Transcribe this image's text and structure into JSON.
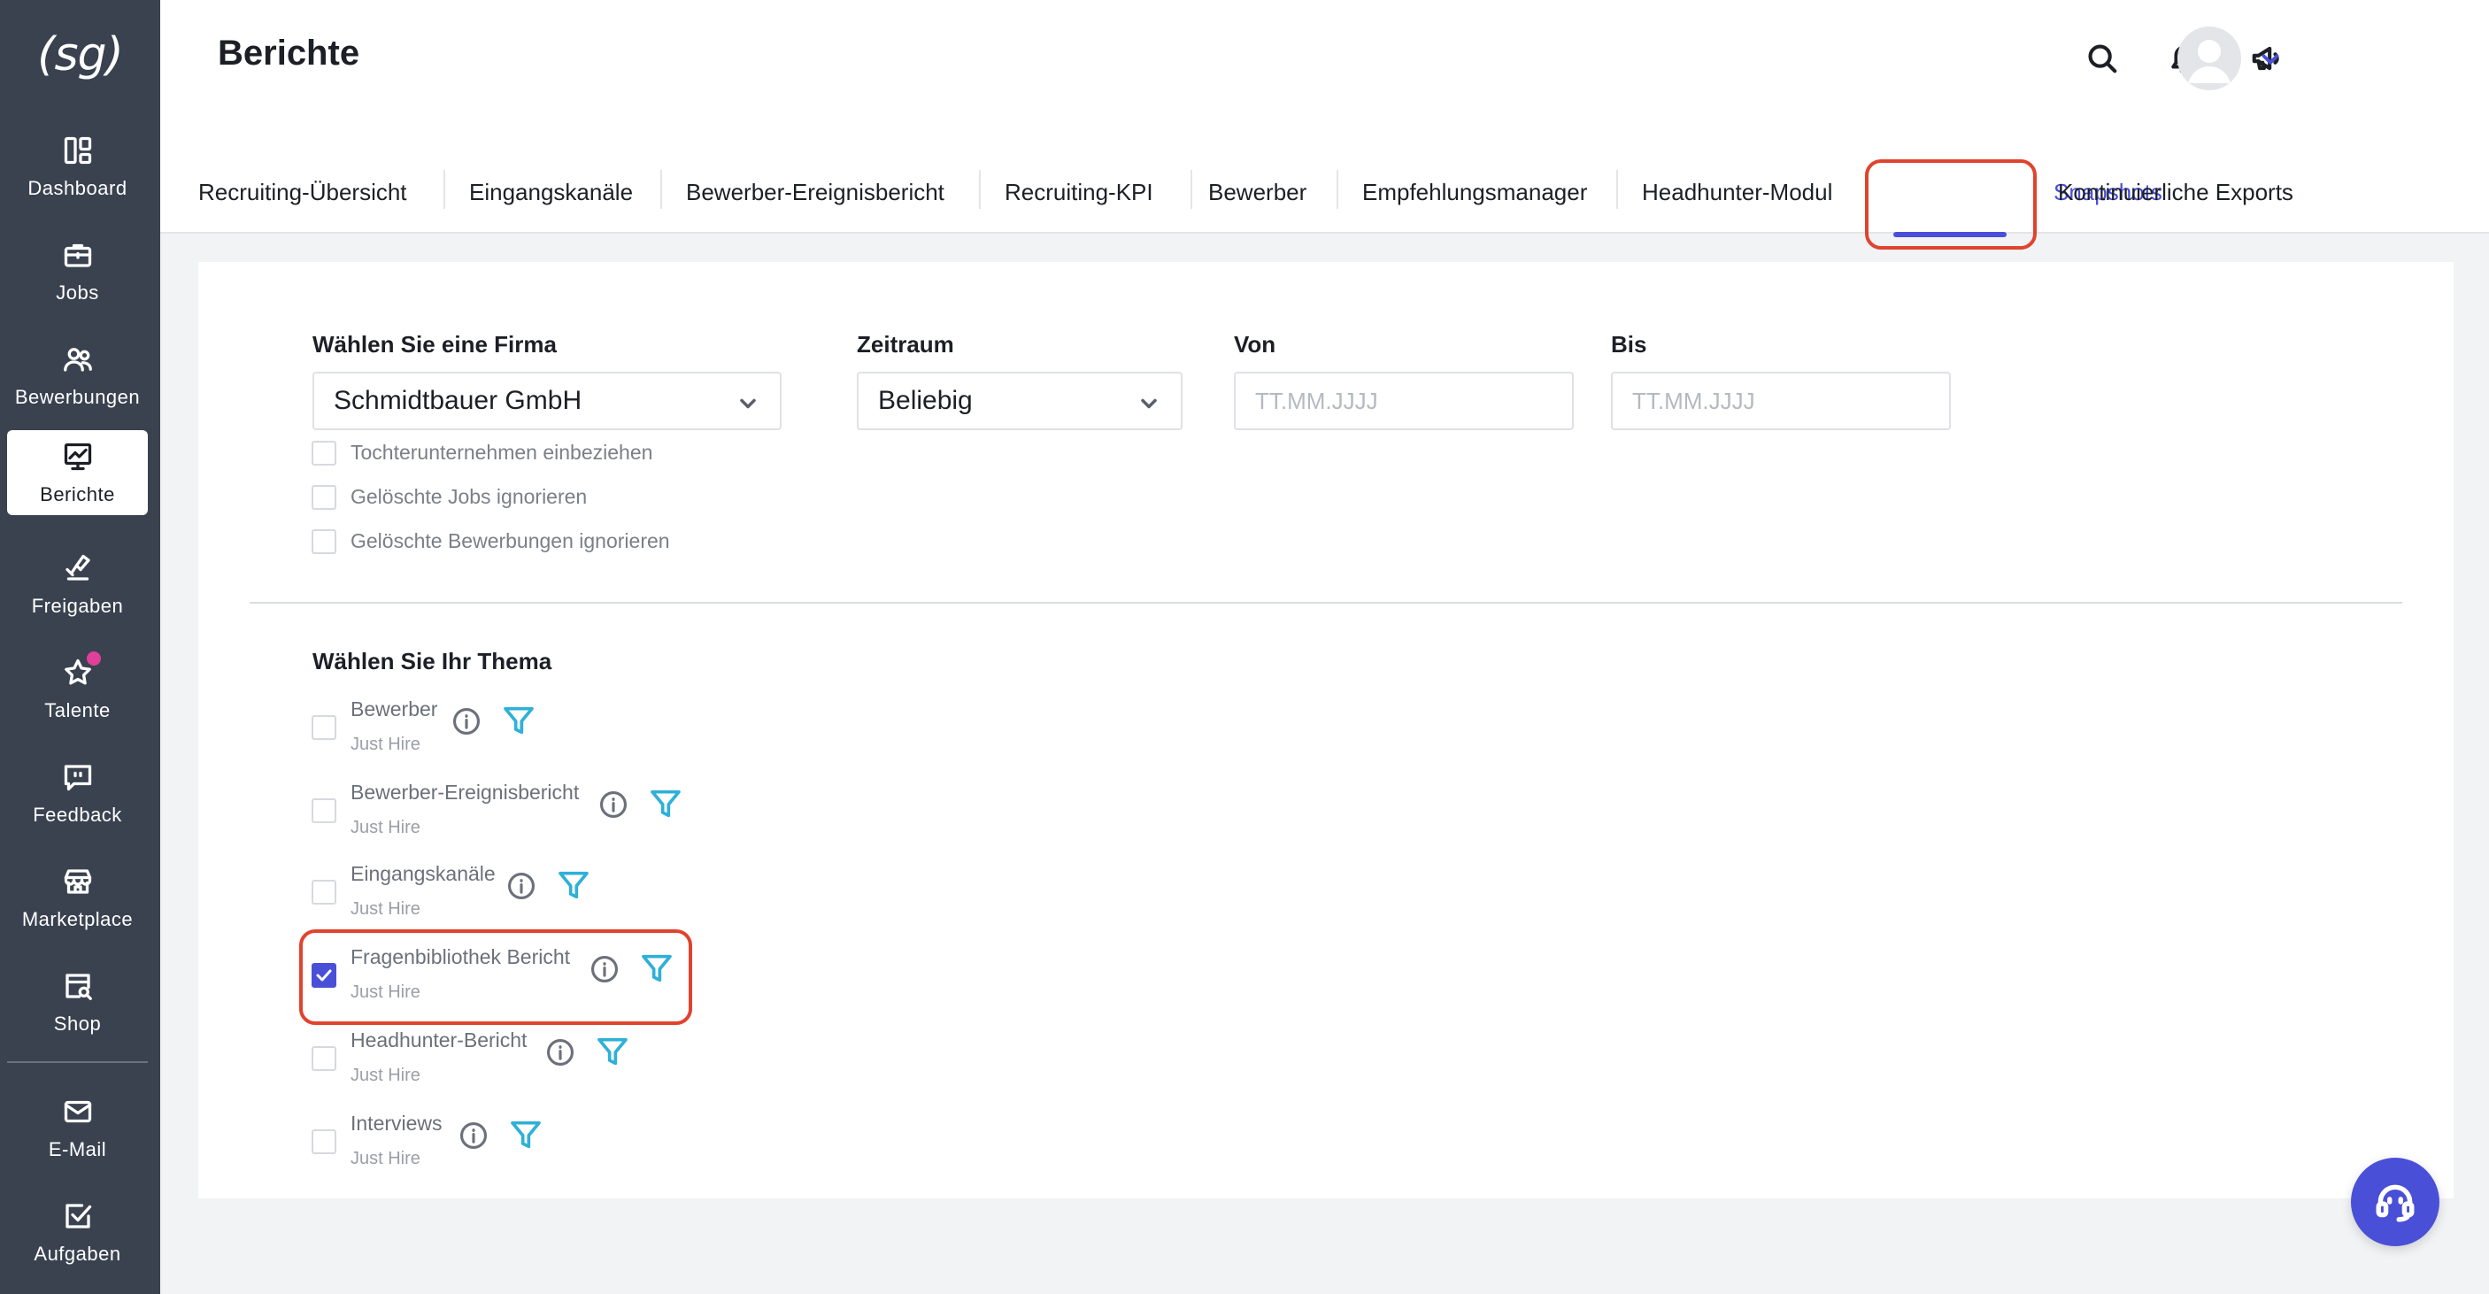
{
  "brand": {
    "logo_text": "(sg)"
  },
  "sidebar": {
    "items": [
      {
        "label": "Dashboard",
        "icon": "dashboard-icon"
      },
      {
        "label": "Jobs",
        "icon": "briefcase-icon"
      },
      {
        "label": "Bewerbungen",
        "icon": "users-icon"
      },
      {
        "label": "Berichte",
        "icon": "chart-icon",
        "active": true
      },
      {
        "label": "Freigaben",
        "icon": "approval-icon"
      },
      {
        "label": "Talente",
        "icon": "star-icon",
        "badge": true
      },
      {
        "label": "Feedback",
        "icon": "feedback-icon"
      },
      {
        "label": "Marketplace",
        "icon": "store-icon"
      },
      {
        "label": "Shop",
        "icon": "shop-icon"
      },
      {
        "label": "E-Mail",
        "icon": "mail-icon"
      },
      {
        "label": "Aufgaben",
        "icon": "task-icon"
      }
    ]
  },
  "header": {
    "title": "Berichte"
  },
  "tabs": [
    {
      "label": "Recruiting-Übersicht"
    },
    {
      "label": "Eingangskanäle"
    },
    {
      "label": "Bewerber-Ereignisbericht"
    },
    {
      "label": "Recruiting-KPI"
    },
    {
      "label": "Bewerber"
    },
    {
      "label": "Empfehlungsmanager"
    },
    {
      "label": "Headhunter-Modul"
    },
    {
      "label": "Snapshots",
      "active": true
    },
    {
      "label": "Kontinuierliche Exports"
    }
  ],
  "filters": {
    "company": {
      "label": "Wählen Sie eine Firma",
      "value": "Schmidtbauer GmbH"
    },
    "period": {
      "label": "Zeitraum",
      "value": "Beliebig"
    },
    "from": {
      "label": "Von",
      "placeholder": "TT.MM.JJJJ"
    },
    "to": {
      "label": "Bis",
      "placeholder": "TT.MM.JJJJ"
    },
    "options": [
      {
        "label": "Tochterunternehmen einbeziehen",
        "checked": false
      },
      {
        "label": "Gelöschte Jobs ignorieren",
        "checked": false
      },
      {
        "label": "Gelöschte Bewerbungen ignorieren",
        "checked": false
      }
    ]
  },
  "topics": {
    "heading": "Wählen Sie Ihr Thema",
    "items": [
      {
        "title": "Bewerber",
        "subtitle": "Just Hire",
        "checked": false
      },
      {
        "title": "Bewerber-Ereignisbericht",
        "subtitle": "Just Hire",
        "checked": false
      },
      {
        "title": "Eingangskanäle",
        "subtitle": "Just Hire",
        "checked": false
      },
      {
        "title": "Fragenbibliothek Bericht",
        "subtitle": "Just Hire",
        "checked": true
      },
      {
        "title": "Headhunter-Bericht",
        "subtitle": "Just Hire",
        "checked": false
      },
      {
        "title": "Interviews",
        "subtitle": "Just Hire",
        "checked": false
      }
    ]
  },
  "colors": {
    "sidebar_bg": "#3a4250",
    "accent": "#4a4fd8",
    "badge": "#e0409a",
    "highlight": "#e0432e",
    "filter_icon": "#2fb0d8"
  }
}
